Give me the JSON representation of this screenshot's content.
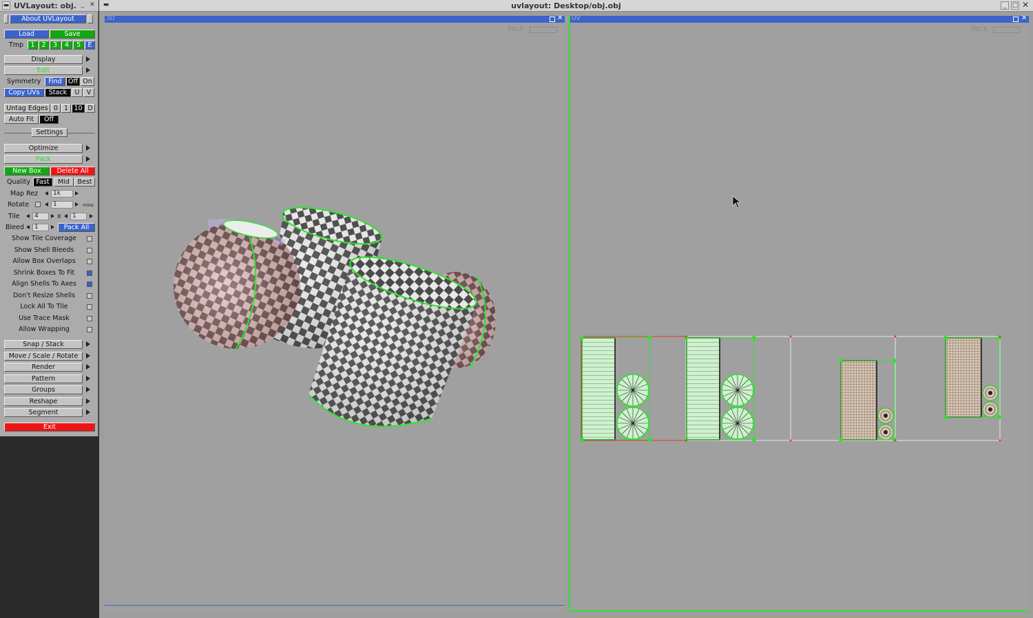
{
  "side_title": "UVLayout: obj.",
  "about": "About UVLayout",
  "load": "Load",
  "save": "Save",
  "tmp": {
    "label": "Tmp",
    "slots": [
      "1",
      "2",
      "3",
      "4",
      "5",
      "E"
    ]
  },
  "display": "Display",
  "edit": "Edit",
  "symmetry": {
    "label": "Symmetry",
    "find": "Find",
    "off": "Off",
    "on": "On"
  },
  "copyuvs": {
    "label": "Copy UVs",
    "stack": "Stack",
    "u": "U",
    "v": "V"
  },
  "untag": {
    "label": "Untag Edges",
    "vals": [
      "0",
      "1",
      "10",
      "D"
    ]
  },
  "autofit": {
    "label": "Auto Fit",
    "val": "Off"
  },
  "settings": "Settings",
  "optimize": "Optimize",
  "pack": "Pack",
  "newbox": "New Box",
  "deleteall": "Delete All",
  "quality": {
    "label": "Quality",
    "fast": "Fast",
    "mid": "Mid",
    "best": "Best"
  },
  "maprez": {
    "label": "Map Rez",
    "val": "1k"
  },
  "rotate": {
    "label": "Rotate",
    "val": "1",
    "unit": "mins"
  },
  "tile": {
    "label": "Tile",
    "a": "4",
    "x": "x",
    "b": "1"
  },
  "bleed": {
    "label": "Bleed",
    "val": "1",
    "packall": "Pack All"
  },
  "options": [
    {
      "label": "Show Tile Coverage",
      "on": false
    },
    {
      "label": "Show Shell Bleeds",
      "on": false
    },
    {
      "label": "Allow Box Overlaps",
      "on": false
    },
    {
      "label": "Shrink Boxes To Fit",
      "on": true
    },
    {
      "label": "Align Shells To Axes",
      "on": true
    },
    {
      "label": "Don't Resize Shells",
      "on": false
    },
    {
      "label": "Lock All To Tile",
      "on": false
    },
    {
      "label": "Use Trace Mask",
      "on": false
    },
    {
      "label": "Allow Wrapping",
      "on": false
    }
  ],
  "menus": [
    "Snap / Stack",
    "Move / Scale / Rotate",
    "Render",
    "Pattern",
    "Groups",
    "Reshape",
    "Segment"
  ],
  "exit": "Exit",
  "win_title": "uvlayout: Desktop/obj.obj",
  "panel3d": {
    "name": "3D",
    "pack": "Pack"
  },
  "paneluv": {
    "name": "UV",
    "pack": "Pack"
  }
}
